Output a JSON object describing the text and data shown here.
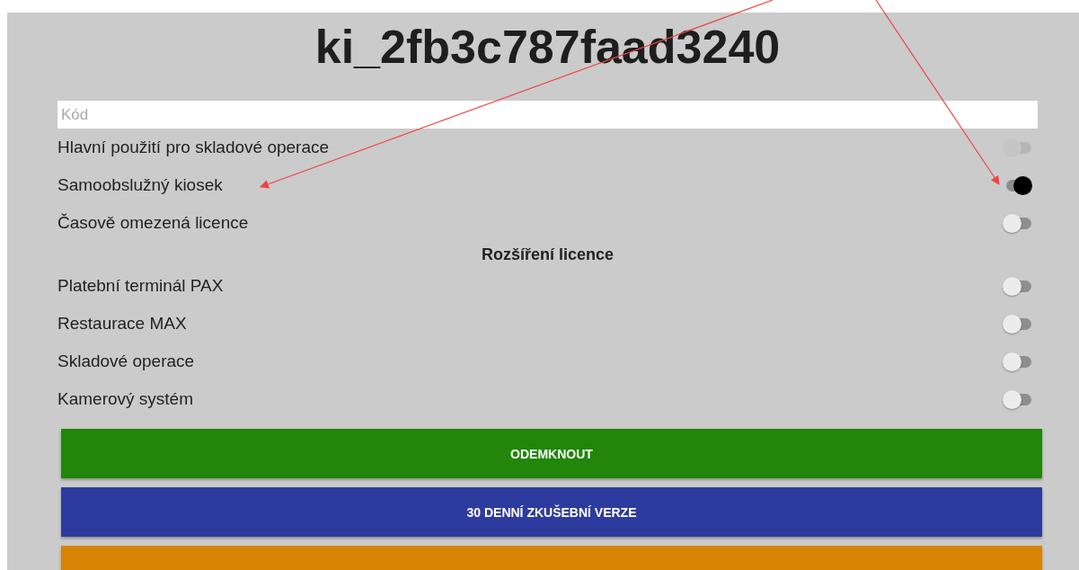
{
  "title": "ki_2fb3c787faad3240",
  "code_field": {
    "placeholder": "Kód"
  },
  "settings": [
    {
      "label": "Hlavní použití pro skladové operace",
      "on": false,
      "disabled": true
    },
    {
      "label": "Samoobslužný kiosek",
      "on": true,
      "disabled": false
    },
    {
      "label": "Časově omezená licence",
      "on": false,
      "disabled": false
    }
  ],
  "extensions_heading": "Rozšíření licence",
  "extensions": [
    {
      "label": "Platební terminál PAX",
      "on": false,
      "disabled": false
    },
    {
      "label": "Restaurace MAX",
      "on": false,
      "disabled": false
    },
    {
      "label": "Skladové operace",
      "on": false,
      "disabled": false
    },
    {
      "label": "Kamerový systém",
      "on": false,
      "disabled": false
    }
  ],
  "buttons": [
    {
      "label": "ODEMKNOUT",
      "color": "#21860a"
    },
    {
      "label": "30 DENNÍ ZKUŠEBNÍ VERZE",
      "color": "#2e3b9e"
    },
    {
      "color": "#d78405"
    }
  ]
}
